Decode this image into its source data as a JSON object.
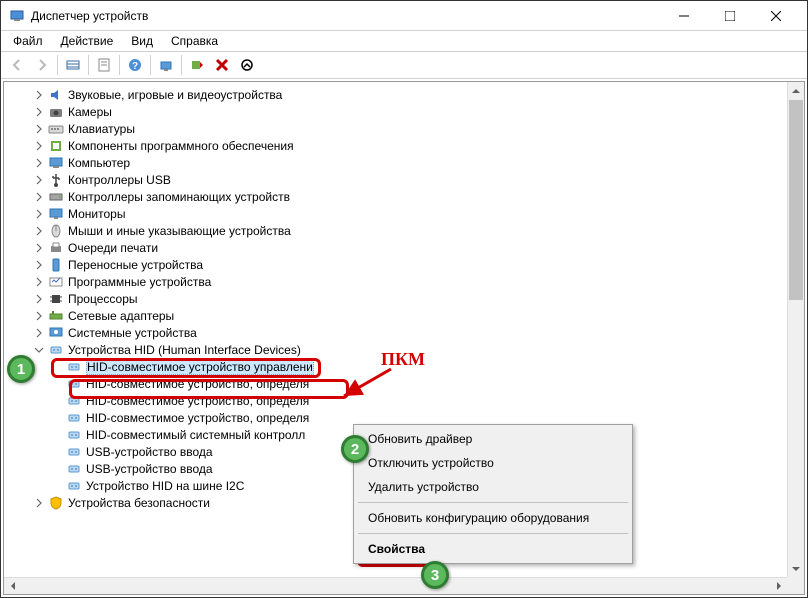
{
  "window": {
    "title": "Диспетчер устройств"
  },
  "menu": {
    "file": "Файл",
    "action": "Действие",
    "view": "Вид",
    "help": "Справка"
  },
  "tree": {
    "categories": [
      {
        "label": "Звуковые, игровые и видеоустройства",
        "icon": "audio"
      },
      {
        "label": "Камеры",
        "icon": "camera"
      },
      {
        "label": "Клавиатуры",
        "icon": "keyboard"
      },
      {
        "label": "Компоненты программного обеспечения",
        "icon": "software"
      },
      {
        "label": "Компьютер",
        "icon": "computer"
      },
      {
        "label": "Контроллеры USB",
        "icon": "usb"
      },
      {
        "label": "Контроллеры запоминающих устройств",
        "icon": "storage"
      },
      {
        "label": "Мониторы",
        "icon": "monitor"
      },
      {
        "label": "Мыши и иные указывающие устройства",
        "icon": "mouse"
      },
      {
        "label": "Очереди печати",
        "icon": "printer"
      },
      {
        "label": "Переносные устройства",
        "icon": "portable"
      },
      {
        "label": "Программные устройства",
        "icon": "software2"
      },
      {
        "label": "Процессоры",
        "icon": "cpu"
      },
      {
        "label": "Сетевые адаптеры",
        "icon": "network"
      },
      {
        "label": "Системные устройства",
        "icon": "system"
      }
    ],
    "hid": {
      "label": "Устройства HID (Human Interface Devices)",
      "children": [
        "HID-совместимое устройство управлени",
        "HID-совместимое устройство, определя",
        "HID-совместимое устройство, определя",
        "HID-совместимое устройство, определя",
        "HID-совместимый системный контролл",
        "USB-устройство ввода",
        "USB-устройство ввода",
        "Устройство HID на шине I2C"
      ]
    },
    "last": {
      "label": "Устройства безопасности",
      "icon": "security"
    }
  },
  "context_menu": {
    "items": [
      {
        "label": "Обновить драйвер",
        "type": "item"
      },
      {
        "label": "Отключить устройство",
        "type": "item"
      },
      {
        "label": "Удалить устройство",
        "type": "item"
      },
      {
        "type": "sep"
      },
      {
        "label": "Обновить конфигурацию оборудования",
        "type": "item"
      },
      {
        "type": "sep"
      },
      {
        "label": "Свойства",
        "type": "item",
        "emph": true
      }
    ]
  },
  "annotations": {
    "pkm": "ПКМ",
    "badge1": "1",
    "badge2": "2",
    "badge3": "3"
  }
}
